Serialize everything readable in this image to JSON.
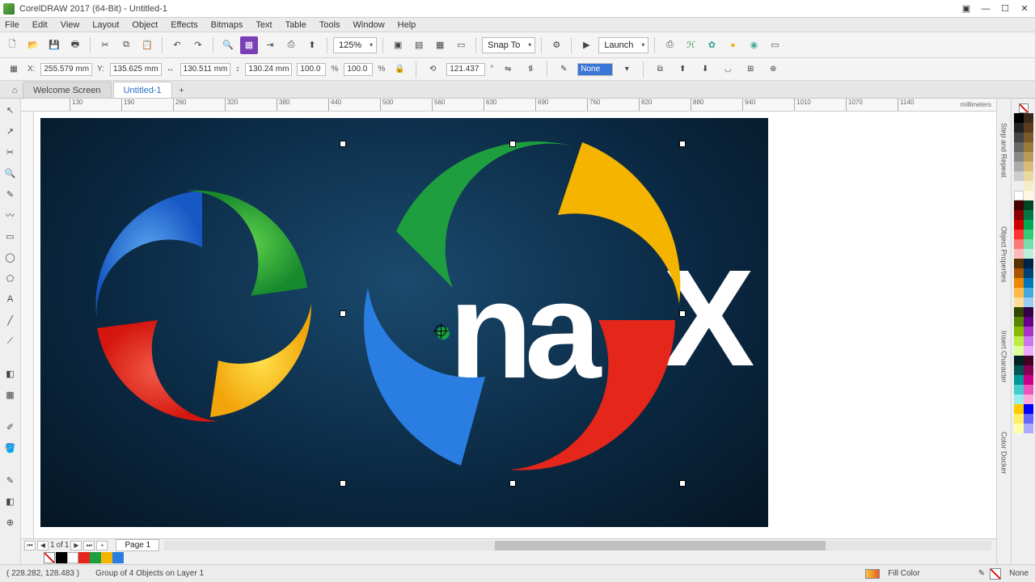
{
  "window": {
    "title": "CorelDRAW 2017 (64-Bit) - Untitled-1"
  },
  "menu": {
    "file": "File",
    "edit": "Edit",
    "view": "View",
    "layout": "Layout",
    "object": "Object",
    "effects": "Effects",
    "bitmaps": "Bitmaps",
    "text": "Text",
    "table": "Table",
    "tools": "Tools",
    "window": "Window",
    "help": "Help"
  },
  "toolbar": {
    "zoom": "125%",
    "snap": "Snap To",
    "launch": "Launch"
  },
  "props": {
    "x": "255.579 mm",
    "y": "135.625 mm",
    "w": "130.511 mm",
    "h": "130.24 mm",
    "sx": "100.0",
    "sy": "100.0",
    "unit": "%",
    "angle": "121.437",
    "outline": "None"
  },
  "tabs": {
    "welcome": "Welcome Screen",
    "doc": "Untitled-1"
  },
  "ruler": {
    "t1": "130",
    "t2": "190",
    "t3": "260",
    "t4": "320",
    "t5": "380",
    "t6": "440",
    "t7": "500",
    "t8": "560",
    "t9": "630",
    "t10": "690",
    "t11": "760",
    "t12": "820",
    "t13": "880",
    "t14": "940",
    "t15": "1010",
    "t16": "1070",
    "t17": "1140",
    "unit": "millimeters"
  },
  "pager": {
    "current": "1",
    "of": "of",
    "total": "1",
    "page": "Page 1"
  },
  "dockers": {
    "d1": "Step and Repeat",
    "d2": "Object Properties",
    "d3": "Insert Character",
    "d4": "Color Docker"
  },
  "status": {
    "coords": "( 228.282, 128.483 )",
    "sel": "Group of 4 Objects on Layer 1",
    "fill": "Fill Color",
    "outline": "None"
  },
  "canvas": {
    "textX": "X",
    "textA": "na"
  }
}
